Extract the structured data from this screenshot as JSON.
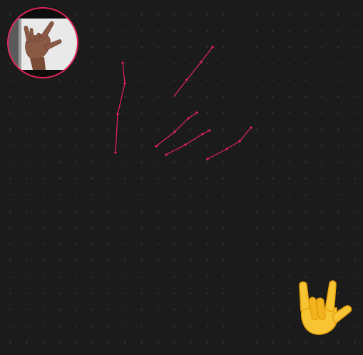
{
  "camera": {
    "ring_color": "#e8245a",
    "preview_content": "hand-gesture-photo"
  },
  "hand_trace": {
    "stroke_color": "#e8245a",
    "fingers": [
      "thumb",
      "index",
      "middle",
      "ring",
      "pinky"
    ]
  },
  "gesture": {
    "icon": "love-you-gesture-icon",
    "emoji_color": "#f7c533",
    "outline_color": "#e8a10c"
  },
  "canvas": {
    "background": "#1b1b1b",
    "dot_grid_color": "#383838"
  }
}
